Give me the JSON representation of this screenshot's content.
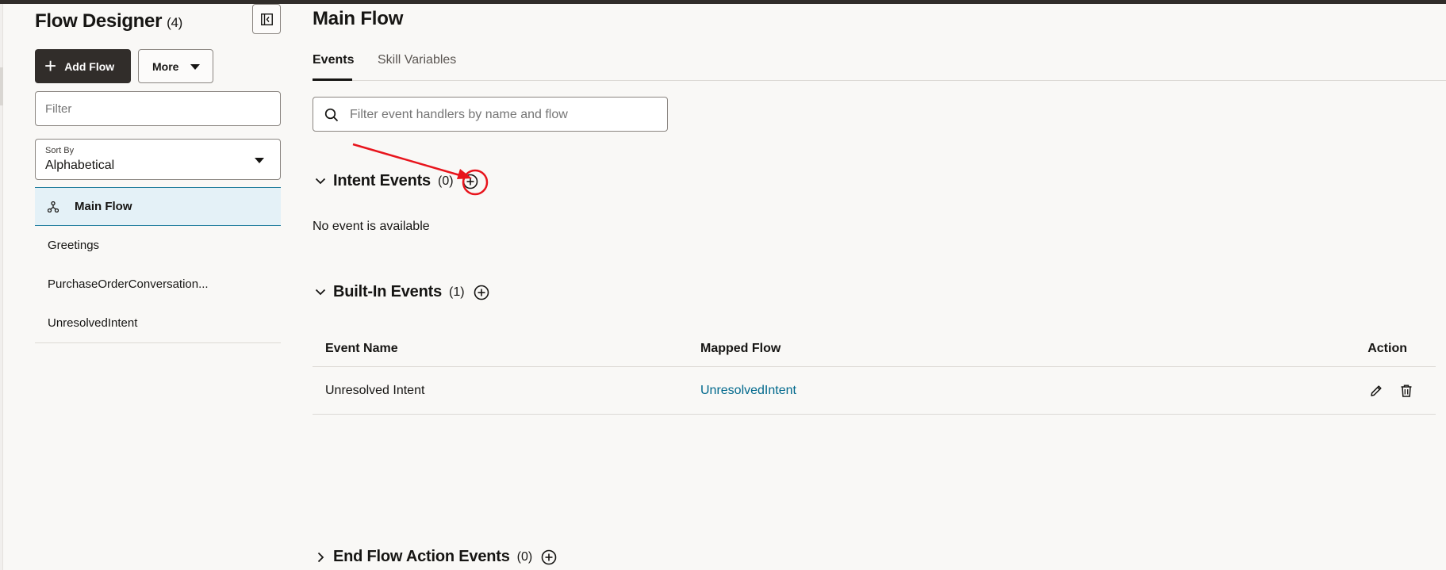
{
  "sidebar": {
    "title": "Flow Designer",
    "count": "(4)",
    "add_flow_label": "Add Flow",
    "more_label": "More",
    "filter_placeholder": "Filter",
    "sort_by_label": "Sort By",
    "sort_by_value": "Alphabetical",
    "flows": [
      {
        "label": "Main Flow",
        "selected": true,
        "icon": "flow-icon"
      },
      {
        "label": "Greetings"
      },
      {
        "label": "PurchaseOrderConversation..."
      },
      {
        "label": "UnresolvedIntent"
      }
    ]
  },
  "main": {
    "title": "Main Flow",
    "tabs": [
      {
        "label": "Events",
        "active": true
      },
      {
        "label": "Skill Variables"
      }
    ],
    "search_placeholder": "Filter event handlers by name and flow",
    "sections": {
      "intent": {
        "title": "Intent Events",
        "count": "(0)",
        "empty_message": "No event is available"
      },
      "builtin": {
        "title": "Built-In Events",
        "count": "(1)"
      },
      "endflow": {
        "title": "End Flow Action Events",
        "count": "(0)"
      }
    },
    "table": {
      "columns": [
        "Event Name",
        "Mapped Flow",
        "Action"
      ],
      "rows": [
        {
          "event_name": "Unresolved Intent",
          "mapped_flow": "UnresolvedIntent"
        }
      ]
    }
  },
  "colors": {
    "accent_link": "#00688c",
    "selected_bg": "#e4f1f7",
    "selected_border": "#227e9e",
    "primary_button": "#312d2a",
    "annotation_red": "#e8141c"
  },
  "icons": [
    "collapse-panel-icon",
    "plus-icon",
    "chevron-down-icon",
    "search-icon",
    "flow-icon",
    "add-circle-icon",
    "chevron-right-icon",
    "edit-icon",
    "delete-icon"
  ]
}
